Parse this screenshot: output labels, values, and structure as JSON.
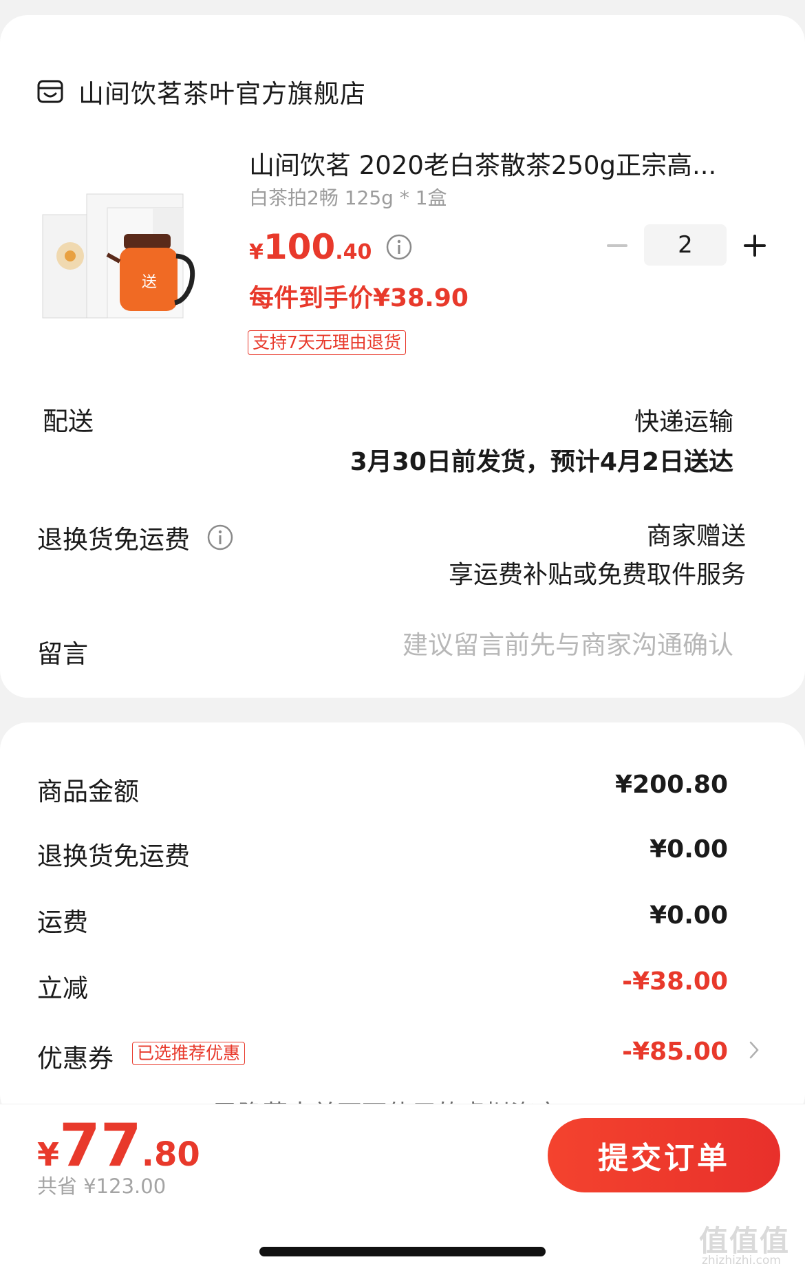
{
  "store": {
    "name": "山间饮茗茶叶官方旗舰店"
  },
  "product": {
    "title": "山间饮茗 2020老白茶散茶250g正宗高...",
    "spec": "白茶拍2畅 125g * 1盒",
    "price_symbol": "¥",
    "price_int": "100",
    "price_dec": ".40",
    "unit_price": "每件到手价¥38.90",
    "return_badge": "支持7天无理由退货",
    "quantity": "2",
    "image_gift_label": "送"
  },
  "delivery": {
    "label": "配送",
    "method": "快递运输",
    "eta": "3月30日前发货，预计4月2日送达"
  },
  "return_shipping": {
    "label": "退换货免运费",
    "value": "商家赠送",
    "desc": "享运费补贴或免费取件服务"
  },
  "message": {
    "label": "留言",
    "placeholder": "建议留言前先与商家沟通确认"
  },
  "summary": {
    "rows": [
      {
        "label": "商品金额",
        "value": "¥200.80"
      },
      {
        "label": "退换货免运费",
        "value": "¥0.00"
      },
      {
        "label": "运费",
        "value": "¥0.00"
      },
      {
        "label": "立减",
        "value": "-¥38.00"
      },
      {
        "label": "优惠券",
        "value": "-¥85.00",
        "badge": "已选推荐优惠"
      }
    ],
    "hidden_note": "已隐藏本单不可使用的虚拟资产"
  },
  "footer": {
    "total_symbol": "¥",
    "total_int": "77",
    "total_dec": ".80",
    "saved": "共省 ¥123.00",
    "submit_label": "提交订单"
  },
  "watermark": {
    "main": "值值值",
    "sub": "zhizhizhi.com"
  },
  "colors": {
    "accent": "#e8392b",
    "placeholder": "#b7b7b7",
    "muted": "#9c9c9c"
  }
}
